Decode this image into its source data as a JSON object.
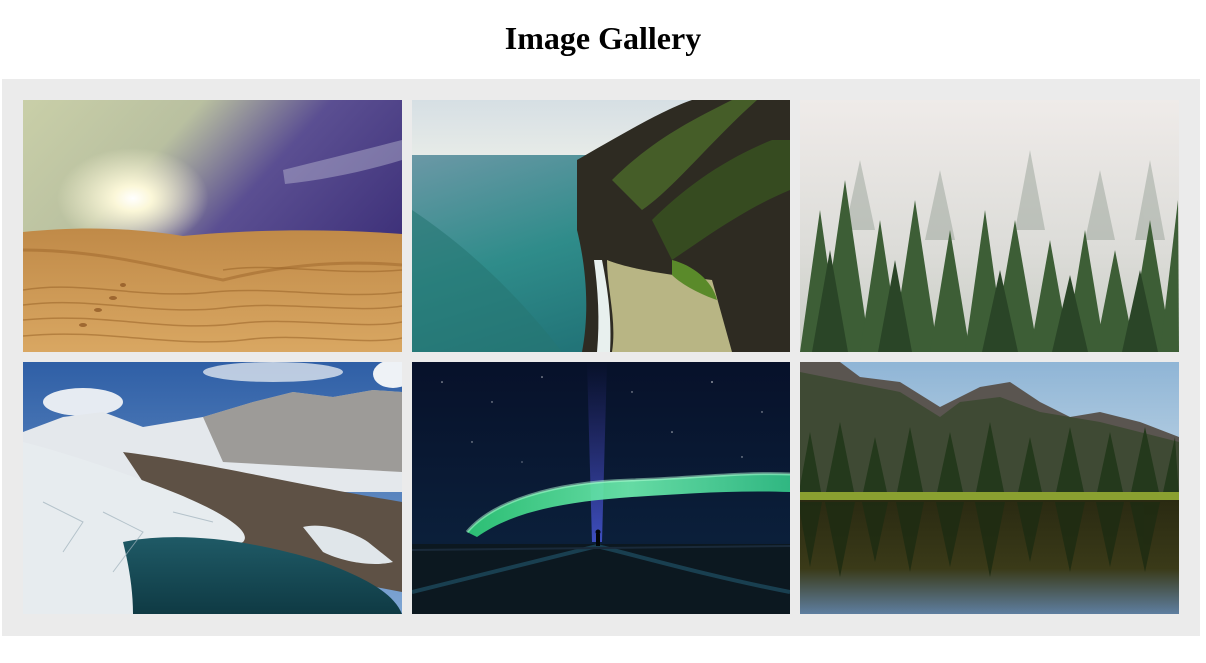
{
  "page": {
    "title": "Image Gallery"
  },
  "gallery": {
    "background_color": "#ebebeb",
    "images": [
      {
        "subject": "desert-dunes"
      },
      {
        "subject": "coastal-cliffs"
      },
      {
        "subject": "misty-forest"
      },
      {
        "subject": "glacier-lake"
      },
      {
        "subject": "aurora-night"
      },
      {
        "subject": "mountain-lake-reflection"
      }
    ]
  }
}
